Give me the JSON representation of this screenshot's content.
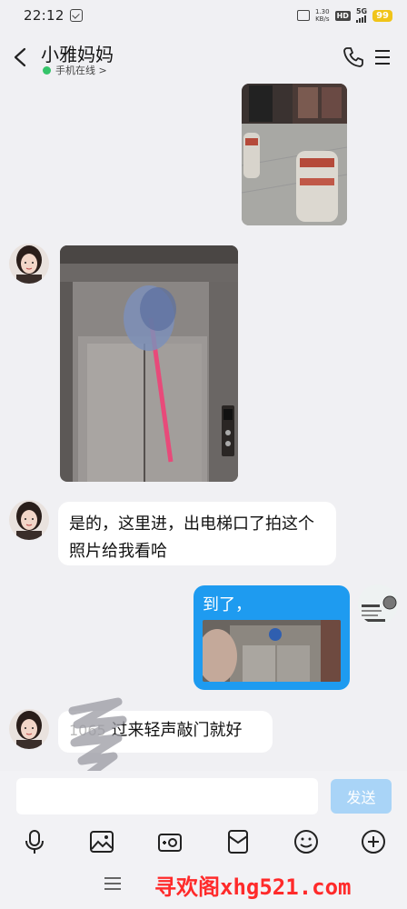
{
  "status": {
    "time": "22:12",
    "speed_value": "1.30",
    "speed_unit": "KB/s",
    "hd": "HD",
    "network": "5G",
    "battery": "99"
  },
  "header": {
    "contact_name": "小雅妈妈",
    "online_status": "手机在线 >"
  },
  "messages": {
    "msg1_text": "是的，这里进，出电梯口了拍这个照片给我看哈",
    "msg2_text": "到了，",
    "msg3_text": "过来轻声敲门就好",
    "msg3_scribble": "1065"
  },
  "input": {
    "placeholder": "",
    "send_label": "发送"
  },
  "footer": {
    "watermark": "寻欢阁xhg521.com"
  },
  "colors": {
    "accent": "#1e9bf0",
    "send_disabled": "#a9d4f7",
    "online_dot": "#35c46a",
    "watermark": "#ff2a2a"
  }
}
